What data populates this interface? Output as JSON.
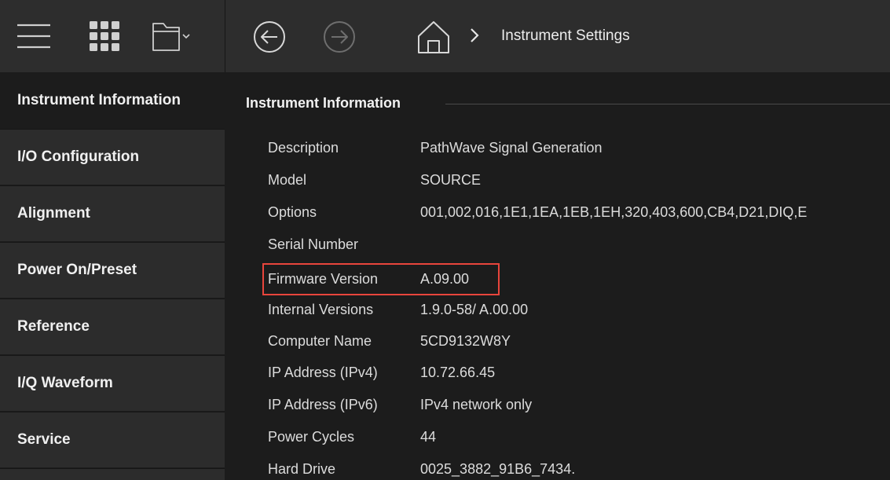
{
  "toolbar": {
    "icons": [
      "menu-icon",
      "app-grid-icon",
      "folder-icon",
      "chevron-down-icon",
      "back-arrow-icon",
      "forward-arrow-icon",
      "home-icon",
      "chevron-right-icon"
    ],
    "breadcrumb": "Instrument Settings"
  },
  "sidebar": {
    "items": [
      {
        "label": "Instrument Information",
        "selected": true
      },
      {
        "label": "I/O Configuration",
        "selected": false
      },
      {
        "label": "Alignment",
        "selected": false
      },
      {
        "label": "Power On/Preset",
        "selected": false
      },
      {
        "label": "Reference",
        "selected": false
      },
      {
        "label": "I/Q Waveform",
        "selected": false
      },
      {
        "label": "Service",
        "selected": false
      }
    ]
  },
  "main": {
    "group_title": "Instrument Information",
    "rows": [
      {
        "label": "Description",
        "value": "PathWave Signal Generation"
      },
      {
        "label": "Model",
        "value": "SOURCE"
      },
      {
        "label": "Options",
        "value": "001,002,016,1E1,1EA,1EB,1EH,320,403,600,CB4,D21,DIQ,E"
      },
      {
        "label": "Serial Number",
        "value": ""
      },
      {
        "label": "Firmware Version",
        "value": "A.09.00"
      },
      {
        "label": "Internal Versions",
        "value": "1.9.0-58/ A.00.00"
      },
      {
        "label": "Computer Name",
        "value": "5CD9132W8Y"
      },
      {
        "label": "IP Address (IPv4)",
        "value": "10.72.66.45"
      },
      {
        "label": "IP Address (IPv6)",
        "value": "IPv4 network only"
      },
      {
        "label": "Power Cycles",
        "value": "44"
      },
      {
        "label": "Hard Drive",
        "value": "0025_3882_91B6_7434."
      }
    ]
  },
  "colors": {
    "toolbar_bg": "#2d2d2d",
    "panel_bg": "#1c1c1c",
    "sidebar_item_bg": "#2c2c2c",
    "highlight": "#e8453c"
  }
}
